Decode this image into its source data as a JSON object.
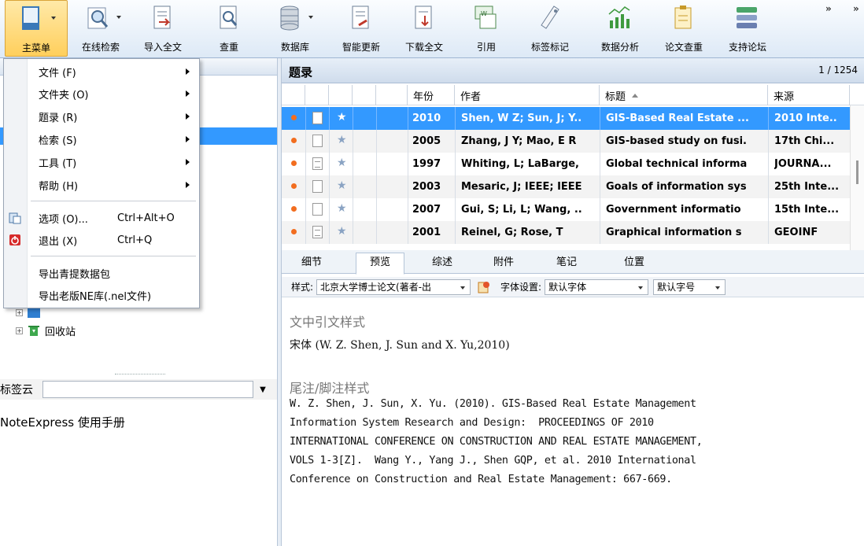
{
  "toolbar": {
    "buttons": [
      {
        "label": "主菜单",
        "icon": "main-menu-icon"
      },
      {
        "label": "在线检索",
        "icon": "online-search-icon"
      },
      {
        "label": "导入全文",
        "icon": "import-fulltext-icon"
      },
      {
        "label": "查重",
        "icon": "duplicate-check-icon"
      },
      {
        "label": "数据库",
        "icon": "database-icon"
      },
      {
        "label": "智能更新",
        "icon": "smart-update-icon"
      },
      {
        "label": "下载全文",
        "icon": "download-fulltext-icon"
      },
      {
        "label": "引用",
        "icon": "cite-icon"
      },
      {
        "label": "标签标记",
        "icon": "tag-icon"
      },
      {
        "label": "数据分析",
        "icon": "data-analysis-icon"
      },
      {
        "label": "论文查重",
        "icon": "paper-check-icon"
      },
      {
        "label": "支持论坛",
        "icon": "forum-icon"
      }
    ],
    "more": "»"
  },
  "main_menu": {
    "items": [
      {
        "label": "文件 (F)",
        "submenu": true
      },
      {
        "label": "文件夹 (O)",
        "submenu": true
      },
      {
        "label": "题录 (R)",
        "submenu": true
      },
      {
        "label": "检索 (S)",
        "submenu": true
      },
      {
        "label": "工具 (T)",
        "submenu": true
      },
      {
        "label": "帮助 (H)",
        "submenu": true
      },
      {
        "label": "选项 (O)...",
        "shortcut": "Ctrl+Alt+O"
      },
      {
        "label": "退出 (X)",
        "shortcut": "Ctrl+Q"
      },
      {
        "label": "导出青提数据包"
      },
      {
        "label": "导出老版NE库(.nel文件)"
      }
    ]
  },
  "left_pane": {
    "recycle_bin": "回收站",
    "tag_cloud_label": "标签云",
    "tag_cloud_value": "",
    "manual": "NoteExpress 使用手册"
  },
  "records": {
    "title": "题录",
    "count": "1 / 1254",
    "columns": {
      "year": "年份",
      "author": "作者",
      "title": "标题",
      "source": "来源"
    },
    "rows": [
      {
        "year": "2010",
        "author": "Shen, W Z; Sun, J; Y..",
        "title": "GIS-Based Real Estate ...",
        "source": "2010 Inte..",
        "selected": true,
        "doc": "blank"
      },
      {
        "year": "2005",
        "author": "Zhang, J Y; Mao, E R",
        "title": "GIS-based study on fusi.",
        "source": "17th Chi...",
        "doc": "blank"
      },
      {
        "year": "1997",
        "author": "Whiting, L; LaBarge,",
        "title": "Global technical informa",
        "source": "JOURNA...",
        "doc": "lined"
      },
      {
        "year": "2003",
        "author": "Mesaric, J; IEEE; IEEE",
        "title": "Goals of information sys",
        "source": "25th Inte...",
        "doc": "blank"
      },
      {
        "year": "2007",
        "author": "Gui, S; Li, L; Wang, ..",
        "title": "Government informatio",
        "source": "15th Inte...",
        "doc": "blank"
      },
      {
        "year": "2001",
        "author": "Reinel, G; Rose, T",
        "title": "Graphical information s",
        "source": "GEOINF",
        "doc": "lined"
      }
    ]
  },
  "detail": {
    "tabs": [
      "细节",
      "预览",
      "综述",
      "附件",
      "笔记",
      "位置"
    ],
    "active_tab": "预览",
    "style_label": "样式:",
    "style_value": "北京大学博士论文(著者-出",
    "font_label": "字体设置:",
    "font_value": "默认字体",
    "font_size_value": "默认字号",
    "intext_heading": "文中引文样式",
    "intext_citation": "宋体 (W. Z. Shen, J. Sun and X. Yu,2010)",
    "footnote_heading": "尾注/脚注样式",
    "footnote_text": "W. Z. Shen, J. Sun, X. Yu. (2010). GIS-Based Real Estate Management\nInformation System Research and Design:  PROCEEDINGS OF 2010\nINTERNATIONAL CONFERENCE ON CONSTRUCTION AND REAL ESTATE MANAGEMENT,\nVOLS 1-3[Z].  Wang Y., Yang J., Shen GQP, et al. 2010 International\nConference on Construction and Real Estate Management: 667-669."
  }
}
